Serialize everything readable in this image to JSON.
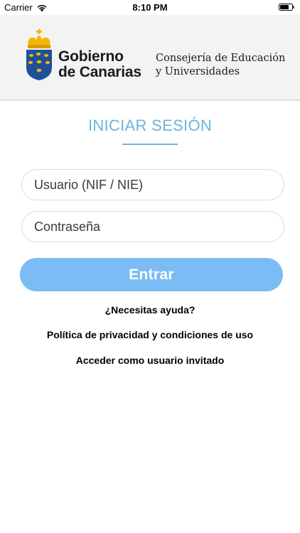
{
  "status_bar": {
    "carrier": "Carrier",
    "time": "8:10 PM"
  },
  "header": {
    "government_line1": "Gobierno",
    "government_line2": "de Canarias",
    "department_line1": "Consejería de Educación",
    "department_line2": "y Universidades"
  },
  "login": {
    "title": "INICIAR SESIÓN",
    "user_placeholder": "Usuario (NIF / NIE)",
    "password_placeholder": "Contraseña",
    "submit_label": "Entrar"
  },
  "links": {
    "help": "¿Necesitas ayuda?",
    "privacy": "Política de privacidad y condiciones de uso",
    "guest": "Acceder como usuario invitado"
  },
  "colors": {
    "accent": "#6cb4dc",
    "button": "#7bbcf5",
    "crest_blue": "#1f4f9a",
    "crest_gold": "#f2b705"
  },
  "icons": {
    "wifi": "wifi-icon",
    "battery": "battery-icon",
    "crest": "coat-of-arms-icon"
  }
}
